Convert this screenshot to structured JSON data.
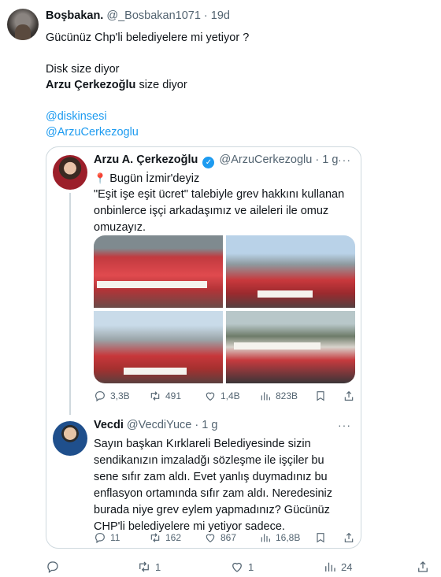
{
  "main_tweet": {
    "author_name": "Boşbakan.",
    "handle_time": "@_Bosbakan1071 · 19d",
    "lines": [
      "Gücünüz Chp'li belediyelere mi yetiyor ?",
      "Disk size diyor"
    ],
    "line3_bold": "Arzu Çerkezoğlu",
    "line3_rest": " size diyor",
    "mentions": [
      "@diskinsesi",
      "@ArzuCerkezoglu"
    ],
    "stats": {
      "reply": "",
      "retweet": "1",
      "like": "1",
      "views": "24"
    }
  },
  "quoted_tweet": {
    "author_name": "Arzu A. Çerkezoğlu",
    "handle_time": "@ArzuCerkezoglu · 1 g",
    "verified_mark": "✓",
    "more": "···",
    "pin": "📍",
    "lines": [
      "Bugün İzmir'deyiz",
      "\"Eşit işe eşit ücret\" talebiyle grev hakkını kullanan",
      "onbinlerce işçi arkadaşımız ve aileleri ile omuz",
      "omuzayız."
    ],
    "stats": {
      "reply": "3,3B",
      "retweet": "491",
      "like": "1,4B",
      "views": "823B"
    }
  },
  "reply_tweet": {
    "author_name": "Vecdi",
    "handle_time": "@VecdiYuce · 1 g",
    "more": "···",
    "lines": [
      "Sayın başkan Kırklareli Belediyesinde sizin",
      "sendikanızın imzaladğı sözleşme ile işçiler bu",
      "sene sıfır zam aldı. Evet yanlış duymadınız bu",
      "enflasyon ortamında sıfır zam aldı. Neredesiniz",
      "burada niye grev eylem yapmadınız? Gücünüz",
      "CHP'li belediyelere mi yetiyor sadece."
    ],
    "stats": {
      "reply": "11",
      "retweet": "162",
      "like": "867",
      "views": "16,8B"
    }
  },
  "colors": {
    "link": "#1d9bf0",
    "muted": "#536471",
    "border": "#cfd9de",
    "verified": "#1d9bf0"
  }
}
